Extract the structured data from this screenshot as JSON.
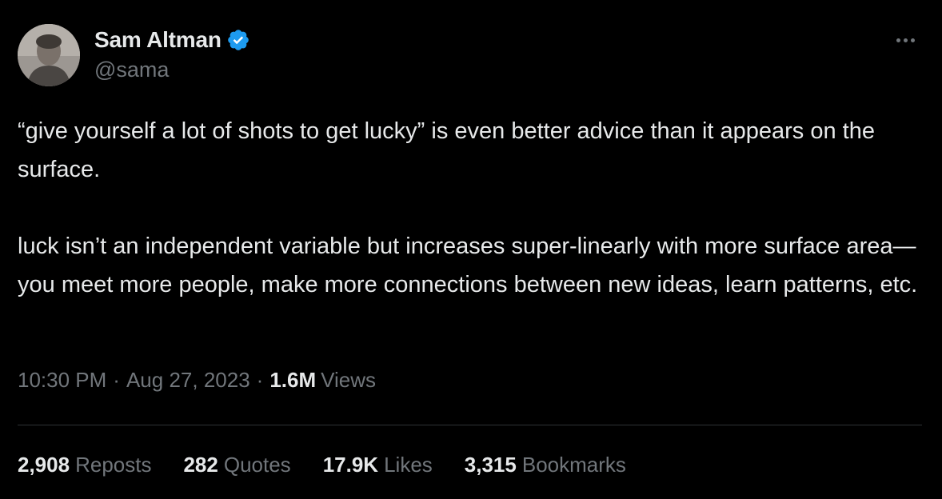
{
  "author": {
    "display_name": "Sam Altman",
    "handle": "@sama",
    "verified": true,
    "verified_icon": "verified-badge-icon",
    "avatar_icon": "avatar"
  },
  "menu": {
    "icon": "more-options-icon"
  },
  "tweet": {
    "paragraphs": [
      "“give yourself a lot of shots to get lucky” is even better advice than it appears on the surface.",
      "luck isn’t an independent variable but increases super-linearly with more surface area—you meet more people, make more connections between new ideas, learn patterns, etc."
    ],
    "time": "10:30 PM",
    "separator": "·",
    "date": "Aug 27, 2023",
    "views_count": "1.6M",
    "views_label": "Views"
  },
  "stats": [
    {
      "count": "2,908",
      "label": "Reposts"
    },
    {
      "count": "282",
      "label": "Quotes"
    },
    {
      "count": "17.9K",
      "label": "Likes"
    },
    {
      "count": "3,315",
      "label": "Bookmarks"
    }
  ],
  "colors": {
    "background": "#000000",
    "text": "#e7e9ea",
    "secondary_text": "#71767b",
    "verified_blue": "#1d9bf0",
    "divider": "#2f3336"
  }
}
